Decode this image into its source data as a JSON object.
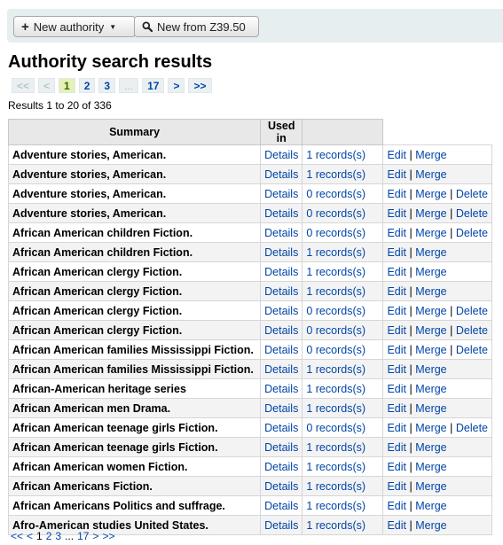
{
  "toolbar": {
    "new_authority": "New authority",
    "new_from_z3950": "New from Z39.50"
  },
  "page_title": "Authority search results",
  "pager_top": {
    "first": "<<",
    "prev": "<",
    "pages": [
      "1",
      "2",
      "3"
    ],
    "ellipsis": "...",
    "last_page": "17",
    "next": ">",
    "last": ">>"
  },
  "results_count": "Results 1 to 20 of 336",
  "table": {
    "headers": [
      "Summary",
      "Used in",
      ""
    ],
    "details_label": "Details",
    "edit_label": "Edit",
    "merge_label": "Merge",
    "delete_label": "Delete",
    "separator": "|",
    "rows": [
      {
        "summary": "Adventure stories, American.",
        "used_in": "1 records(s)",
        "deletable": false
      },
      {
        "summary": "Adventure stories, American.",
        "used_in": "1 records(s)",
        "deletable": false
      },
      {
        "summary": "Adventure stories, American.",
        "used_in": "0 records(s)",
        "deletable": true
      },
      {
        "summary": "Adventure stories, American.",
        "used_in": "0 records(s)",
        "deletable": true
      },
      {
        "summary": "African American children Fiction.",
        "used_in": "0 records(s)",
        "deletable": true
      },
      {
        "summary": "African American children Fiction.",
        "used_in": "1 records(s)",
        "deletable": false
      },
      {
        "summary": "African American clergy Fiction.",
        "used_in": "1 records(s)",
        "deletable": false
      },
      {
        "summary": "African American clergy Fiction.",
        "used_in": "1 records(s)",
        "deletable": false
      },
      {
        "summary": "African American clergy Fiction.",
        "used_in": "0 records(s)",
        "deletable": true
      },
      {
        "summary": "African American clergy Fiction.",
        "used_in": "0 records(s)",
        "deletable": true
      },
      {
        "summary": "African American families Mississippi Fiction.",
        "used_in": "0 records(s)",
        "deletable": true
      },
      {
        "summary": "African American families Mississippi Fiction.",
        "used_in": "1 records(s)",
        "deletable": false
      },
      {
        "summary": "African-American heritage series",
        "used_in": "1 records(s)",
        "deletable": false
      },
      {
        "summary": "African American men Drama.",
        "used_in": "1 records(s)",
        "deletable": false
      },
      {
        "summary": "African American teenage girls Fiction.",
        "used_in": "0 records(s)",
        "deletable": true
      },
      {
        "summary": "African American teenage girls Fiction.",
        "used_in": "1 records(s)",
        "deletable": false
      },
      {
        "summary": "African American women Fiction.",
        "used_in": "1 records(s)",
        "deletable": false
      },
      {
        "summary": "African Americans Fiction.",
        "used_in": "1 records(s)",
        "deletable": false
      },
      {
        "summary": "African Americans Politics and suffrage.",
        "used_in": "1 records(s)",
        "deletable": false
      },
      {
        "summary": "Afro-American studies United States.",
        "used_in": "1 records(s)",
        "deletable": false
      }
    ]
  },
  "pager_bottom": {
    "first": "<<",
    "prev": "<",
    "current": "1",
    "pages": [
      "2",
      "3"
    ],
    "ellipsis": "...",
    "last_page": "17",
    "next": ">",
    "last": ">>"
  }
}
